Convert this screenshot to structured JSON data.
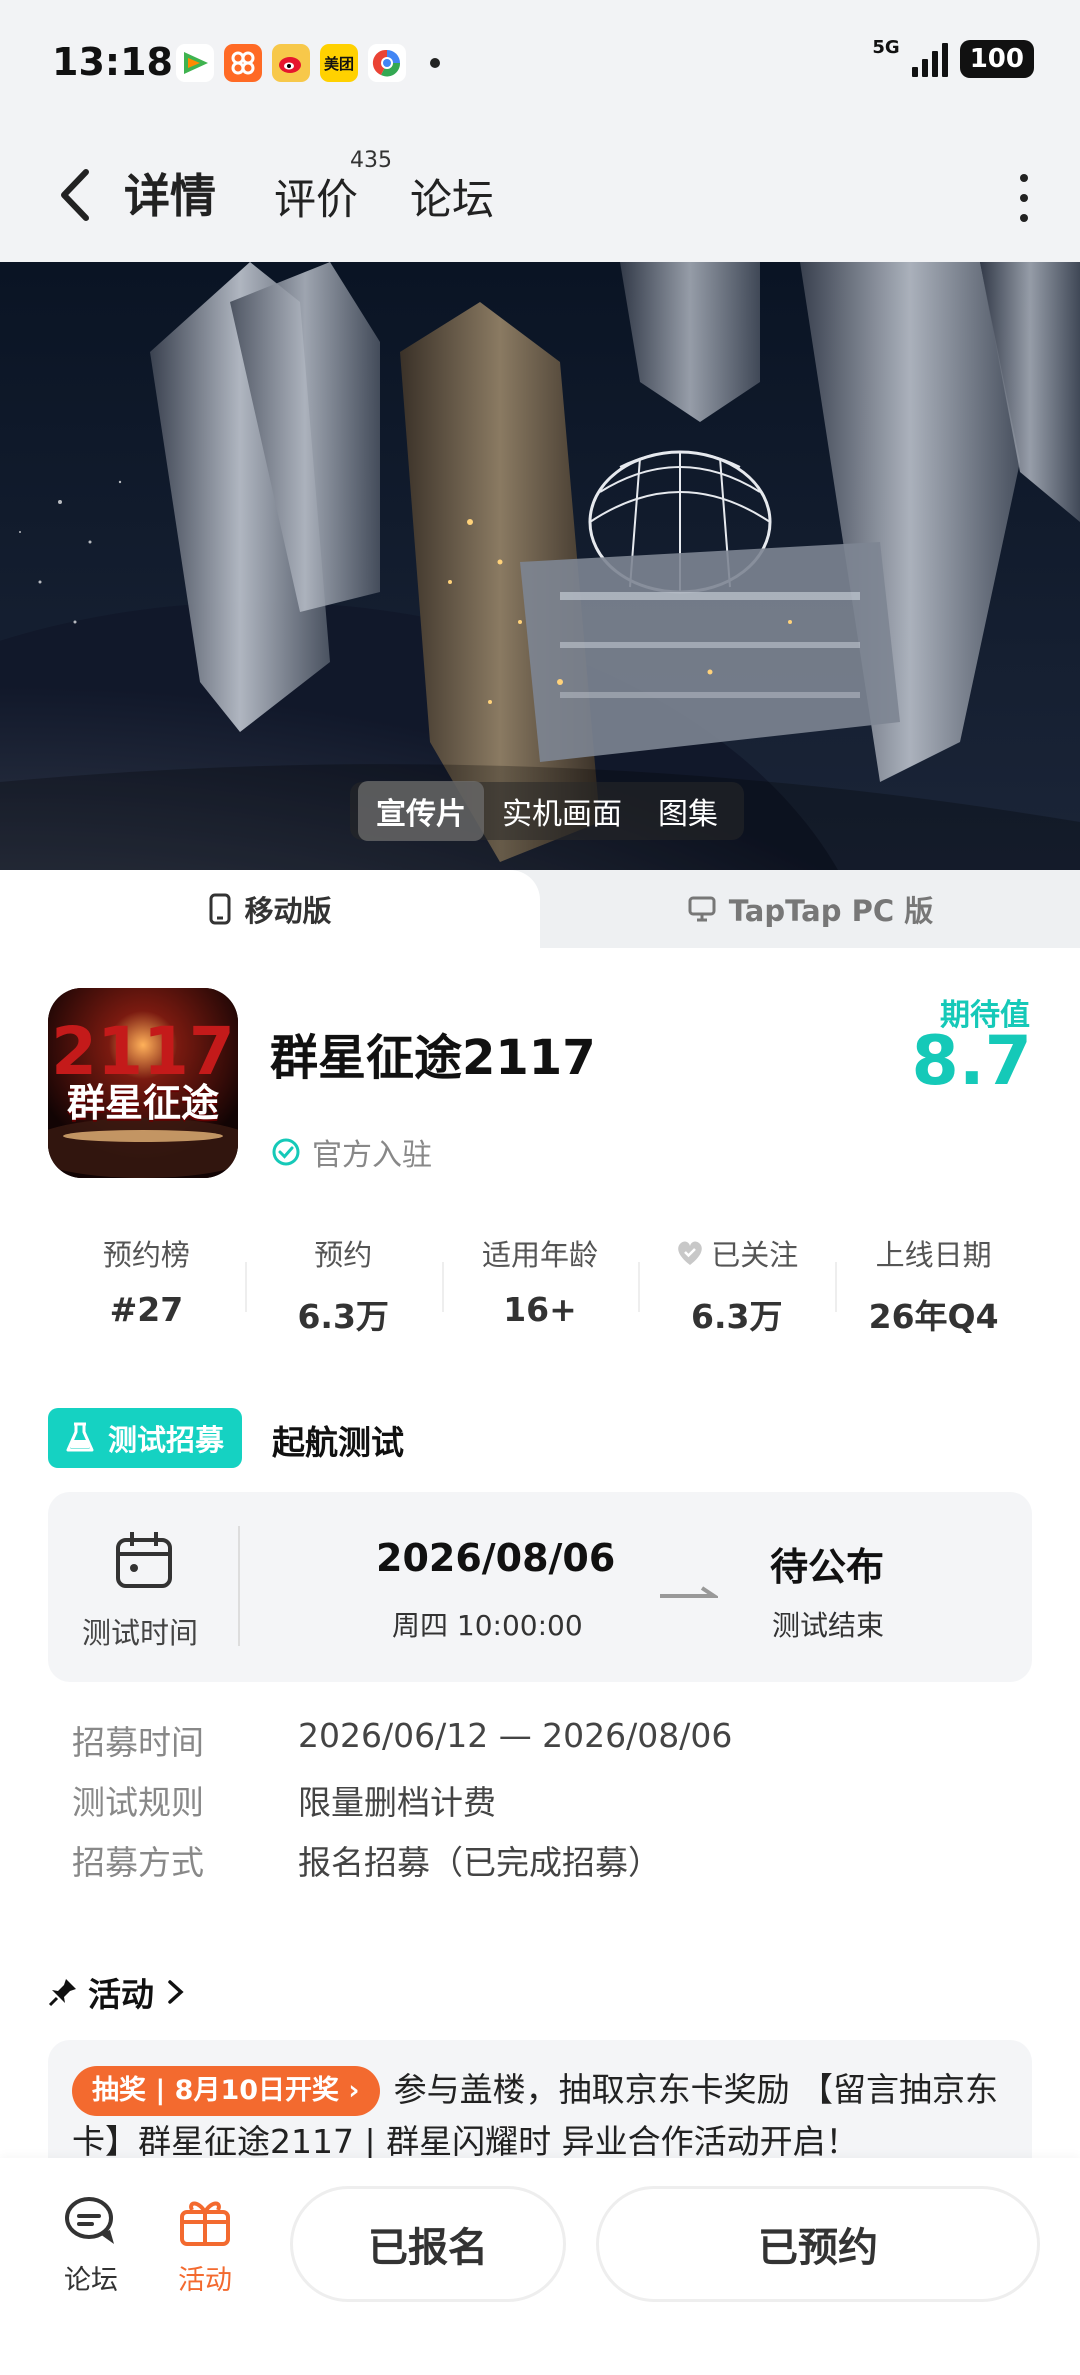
{
  "status_bar": {
    "time": "13:18",
    "network": "5G",
    "battery": "100",
    "app_icons": [
      "tencent-video-icon",
      "kuaikan-icon",
      "weibo-icon",
      "meituan-icon",
      "chrome-like-icon"
    ],
    "meituan_label": "美团"
  },
  "header": {
    "tabs": [
      {
        "label": "详情",
        "active": true
      },
      {
        "label": "评价",
        "badge": "435"
      },
      {
        "label": "论坛"
      }
    ]
  },
  "hero": {
    "media_tabs": [
      "宣传片",
      "实机画面",
      "图集"
    ],
    "active_media_tab": "宣传片"
  },
  "platform": {
    "mobile": "移动版",
    "pc": "TapTap PC 版"
  },
  "game": {
    "title": "群星征途2117",
    "icon_text": "群星征途",
    "official": "官方入驻",
    "expect_label": "期待值",
    "expect_value": "8.7"
  },
  "stats": [
    {
      "label": "预约榜",
      "value": "#27"
    },
    {
      "label": "预约",
      "value": "6.3万"
    },
    {
      "label": "适用年龄",
      "value": "16+"
    },
    {
      "label": "已关注",
      "value": "6.3万"
    },
    {
      "label": "上线日期",
      "value": "26年Q4"
    }
  ],
  "test": {
    "badge": "测试招募",
    "name": "起航测试",
    "card": {
      "time_label": "测试时间",
      "start_date": "2026/08/06",
      "start_time": "周四  10:00:00",
      "end_value": "待公布",
      "end_label": "测试结束"
    },
    "info": [
      {
        "label": "招募时间",
        "value": "2026/06/12 — 2026/08/06"
      },
      {
        "label": "测试规则",
        "value": "限量删档计费"
      },
      {
        "label": "招募方式",
        "value": "报名招募（已完成招募）"
      }
    ]
  },
  "activity": {
    "title": "活动",
    "pill": "抽奖 | 8月10日开奖",
    "text": "参与盖楼，抽取京东卡奖励 【留言抽京东卡】群星征途2117 | 群星闪耀时 异业合作活动开启！"
  },
  "bottom_bar": {
    "forum": "论坛",
    "activity": "活动",
    "signed_up": "已报名",
    "reserved": "已预约"
  },
  "colors": {
    "accent": "#15d2c2",
    "orange": "#f36a2f"
  }
}
